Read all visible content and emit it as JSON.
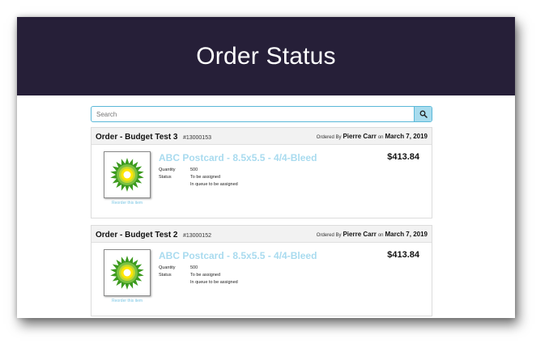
{
  "header": {
    "title": "Order Status"
  },
  "search": {
    "placeholder": "Search"
  },
  "icons": {
    "search": "search-icon",
    "product": "bp-helios-logo-icon"
  },
  "colors": {
    "header_bg": "#261f38",
    "product_link": "#a9dbef",
    "search_border": "#5bb8d8"
  },
  "orders": [
    {
      "title": "Order - Budget Test 3",
      "number": "#13000153",
      "ordered_by_label": "Ordered By",
      "name": "Pierre Carr",
      "on_label": "on",
      "date": "March 7, 2019",
      "product": "ABC Postcard - 8.5x5.5 - 4/4-Bleed",
      "price": "$413.84",
      "quantity_label": "Quantity",
      "quantity": "500",
      "status_label": "Status",
      "status_1": "To be assigned",
      "status_2": "In queue to be assigned",
      "reorder_label": "Reorder this item"
    },
    {
      "title": "Order - Budget Test 2",
      "number": "#13000152",
      "ordered_by_label": "Ordered By",
      "name": "Pierre Carr",
      "on_label": "on",
      "date": "March 7, 2019",
      "product": "ABC Postcard - 8.5x5.5 - 4/4-Bleed",
      "price": "$413.84",
      "quantity_label": "Quantity",
      "quantity": "500",
      "status_label": "Status",
      "status_1": "To be assigned",
      "status_2": "In queue to be assigned",
      "reorder_label": "Reorder this item"
    }
  ]
}
